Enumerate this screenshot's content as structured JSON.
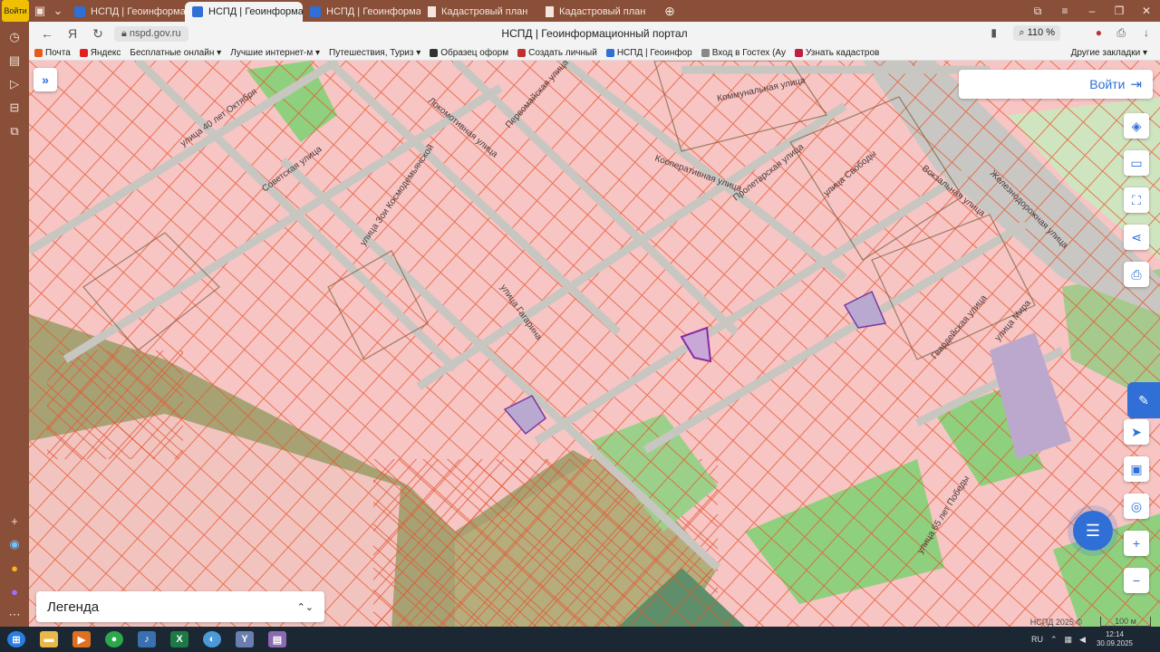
{
  "browser": {
    "tabs": [
      {
        "label": "НСПД | Геоинформацио",
        "active": false
      },
      {
        "label": "НСПД | Геоинформаци",
        "active": true
      },
      {
        "label": "НСПД | Геоинформацио",
        "active": false
      },
      {
        "label": "Кадастровый план",
        "active": false
      },
      {
        "label": "Кадастровый план",
        "active": false
      }
    ],
    "address": "nspd.gov.ru",
    "page_title": "НСПД | Геоинформационный портал",
    "zoom": "110 %",
    "bookmarks": [
      {
        "label": "Почта",
        "color": "#e85a1a"
      },
      {
        "label": "Яндекс",
        "color": "#e02020"
      },
      {
        "label": "Бесплатные онлайн ▾",
        "color": "#999999"
      },
      {
        "label": "Лучшие интернет-м ▾",
        "color": "#999999"
      },
      {
        "label": "Путешествия, Туриз ▾",
        "color": "#999999"
      },
      {
        "label": "Образец оформ",
        "color": "#333333"
      },
      {
        "label": "Создать личный",
        "color": "#c03030"
      },
      {
        "label": "НСПД | Геоинфор",
        "color": "#2f6fd6"
      },
      {
        "label": "Вход в Гостех (Ау",
        "color": "#888888"
      },
      {
        "label": "Узнать кадастров",
        "color": "#c02040"
      }
    ],
    "other_bookmarks": "Другие закладки ▾",
    "login_badge": "Войти"
  },
  "map": {
    "login_label": "Войти",
    "legend_label": "Легенда",
    "copyright": "НСПД 2025 ©",
    "scale_label": "100 м",
    "street_labels": [
      "улица 40 лет Октября",
      "Советская улица",
      "Локомотивная улица",
      "Первомайская улица",
      "улица Зои Космодемьянской",
      "Кооперативная улица",
      "улица Свободы",
      "Вокзальная улица",
      "Гвардейская улица",
      "улица 65 лет Победы",
      "Коммунальная улица",
      "Пролетарская улица",
      "Железнодорожная улица",
      "улица Гагарина",
      "улица Мира"
    ]
  },
  "taskbar": {
    "lang": "RU",
    "time": "12:14",
    "date": "30.09.2025"
  }
}
